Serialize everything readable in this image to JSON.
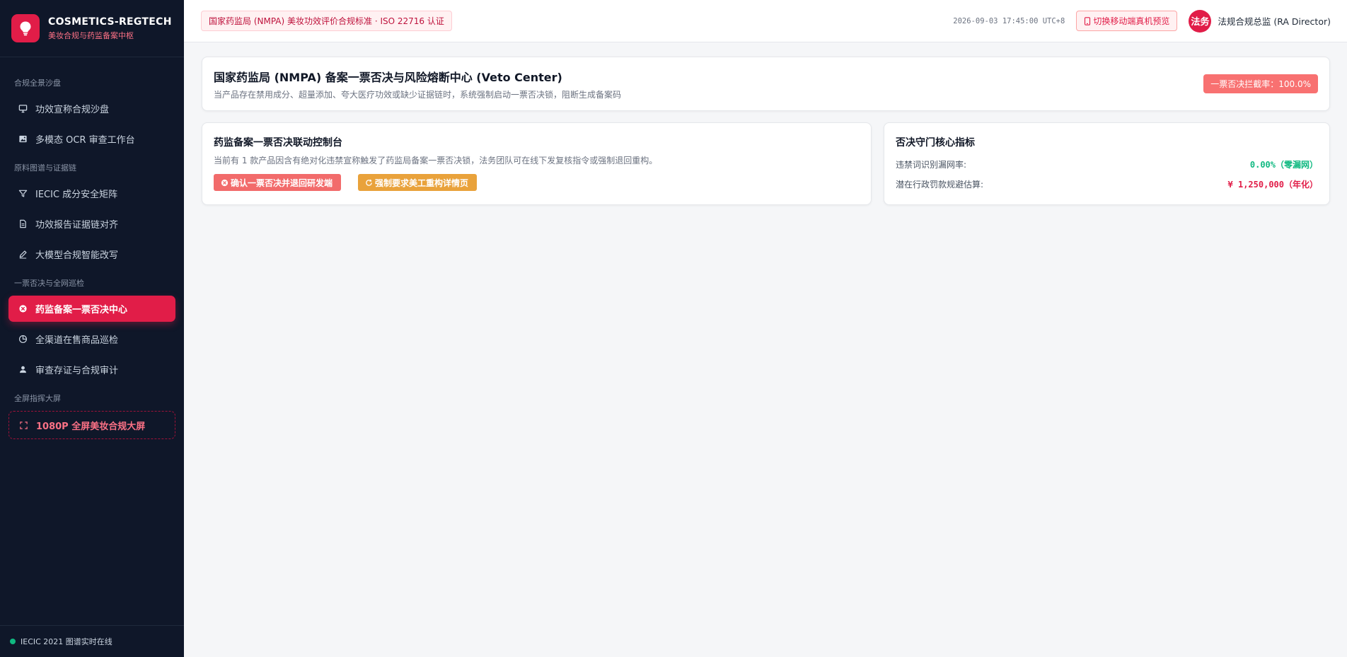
{
  "brand": {
    "name": "COSMETICS-REGTECH",
    "subtitle": "美妆合规与药监备案中枢"
  },
  "sidebar": {
    "groups": [
      {
        "title": "合规全景沙盘",
        "items": [
          {
            "label": "功效宣称合规沙盘",
            "icon": "monitor-icon"
          },
          {
            "label": "多模态 OCR 审查工作台",
            "icon": "image-icon"
          }
        ]
      },
      {
        "title": "原料图谱与证据链",
        "items": [
          {
            "label": "IECIC 成分安全矩阵",
            "icon": "filter-icon"
          },
          {
            "label": "功效报告证据链对齐",
            "icon": "document-icon"
          },
          {
            "label": "大模型合规智能改写",
            "icon": "pen-icon"
          }
        ]
      },
      {
        "title": "一票否决与全网巡检",
        "items": [
          {
            "label": "药监备案一票否决中心",
            "icon": "x-circle-icon",
            "active": true
          },
          {
            "label": "全渠道在售商品巡检",
            "icon": "pie-chart-icon"
          },
          {
            "label": "审查存证与合规审计",
            "icon": "user-stamp-icon"
          }
        ]
      },
      {
        "title": "全屏指挥大屏",
        "items": [
          {
            "label": "1080P 全屏美妆合规大屏",
            "icon": "fullscreen-icon"
          }
        ]
      }
    ],
    "footer": "IECIC 2021 图谱实时在线"
  },
  "topbar": {
    "standard_badge": "国家药监局 (NMPA) 美妆功效评价合规标准 · ISO 22716 认证",
    "datetime": "2026-09-03 17:45:00 UTC+8",
    "mobile_preview_label": "切换移动端真机预览",
    "avatar_text": "法务",
    "user_name": "法规合规总监 (RA Director)"
  },
  "hero": {
    "title": "国家药监局 (NMPA) 备案一票否决与风险熔断中心 (Veto Center)",
    "subtitle": "当产品存在禁用成分、超量添加、夸大医疗功效或缺少证据链时，系统强制启动一票否决锁，阻断生成备案码",
    "rate_badge": "一票否决拦截率：100.0%"
  },
  "console": {
    "title": "药监备案一票否决联动控制台",
    "description": "当前有 1 款产品因含有绝对化违禁宣称触发了药监局备案一票否决锁，法务团队可在线下发复核指令或强制退回重构。",
    "confirm_button": "确认一票否决并退回研发端",
    "rework_button": "强制要求美工重构详情页"
  },
  "metrics": {
    "title": "否决守门核心指标",
    "miss_rate_label": "违禁词识别漏网率:",
    "miss_rate_value": "0.00%（零漏网）",
    "penalty_label": "潜在行政罚款规避估算:",
    "penalty_value": "¥ 1,250,000（年化）"
  },
  "colors": {
    "accent": "#e11d48",
    "sidebar_bg": "#0f1729",
    "success": "#10b981",
    "warning": "#e9a23b"
  }
}
